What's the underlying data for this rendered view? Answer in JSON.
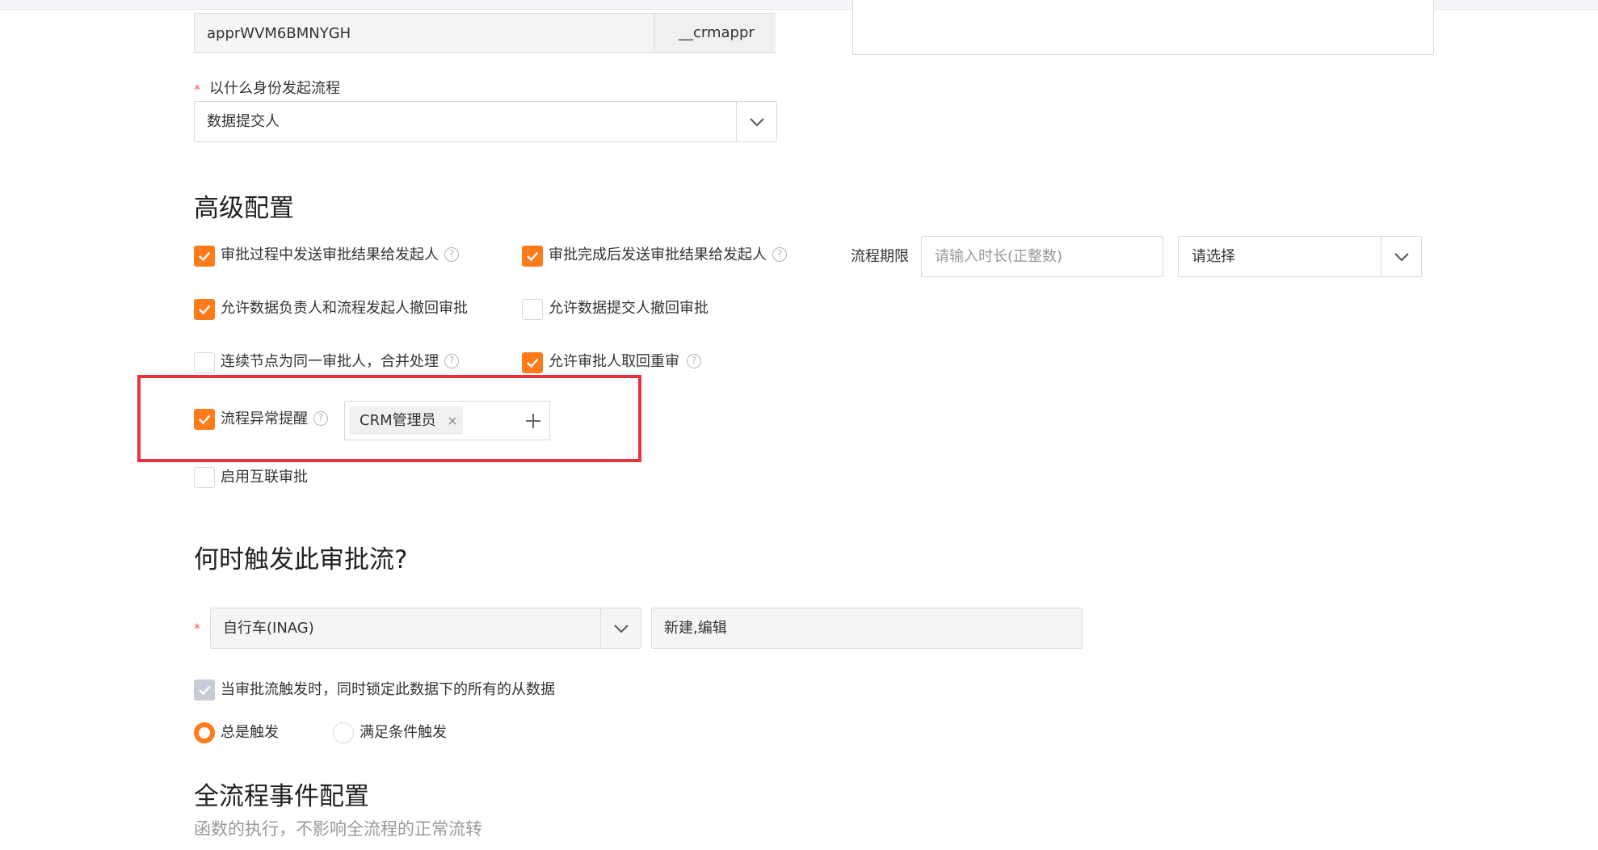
{
  "top_form": {
    "api_name_value": "apprWVM6BMNYGH",
    "api_name_suffix": "__crmappr",
    "initiator_label": "以什么身份发起流程",
    "initiator_value": "数据提交人"
  },
  "advanced": {
    "title": "高级配置",
    "options": {
      "send_result_during": "审批过程中发送审批结果给发起人",
      "send_result_after": "审批完成后发送审批结果给发起人",
      "allow_owner_recall": "允许数据负责人和流程发起人撤回审批",
      "allow_submitter_recall": "允许数据提交人撤回审批",
      "merge_consecutive": "连续节点为同一审批人，合并处理",
      "allow_retrieve": "允许审批人取回重审",
      "exception_alert": "流程异常提醒",
      "enable_interconnect": "启用互联审批"
    },
    "deadline_label": "流程期限",
    "deadline_placeholder": "请输入时长(正整数)",
    "deadline_unit_value": "请选择",
    "alert_tag": "CRM管理员"
  },
  "trigger": {
    "title": "何时触发此审批流?",
    "object_value": "自行车(INAG)",
    "action_value": "新建,编辑",
    "lock_label": "当审批流触发时，同时锁定此数据下的所有的从数据",
    "radio_always": "总是触发",
    "radio_condition": "满足条件触发"
  },
  "events": {
    "title": "全流程事件配置",
    "subtitle": "函数的执行，不影响全流程的正常流转"
  },
  "icons": {
    "check": "check-icon",
    "help": "question-circle-icon",
    "chevron": "chevron-down-icon",
    "plus": "plus-icon",
    "close": "close-icon"
  },
  "colors": {
    "accent": "#ff7b1a",
    "highlight_frame": "#e8333c",
    "required": "#f05a5a"
  }
}
